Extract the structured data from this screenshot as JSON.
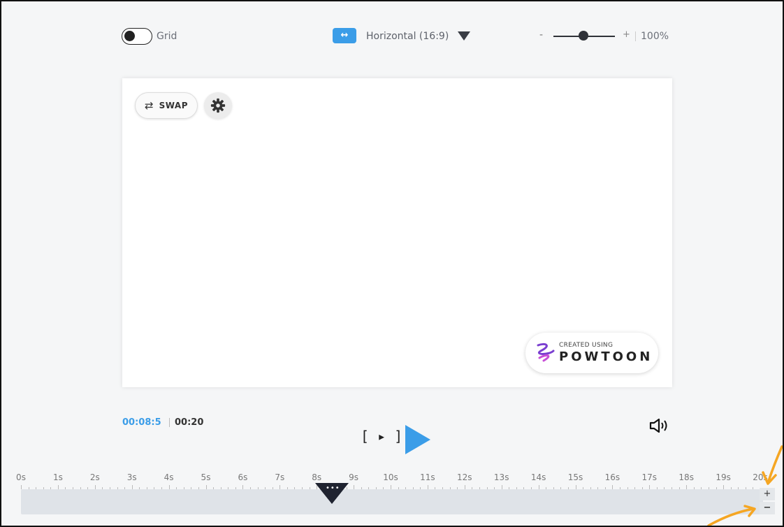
{
  "toolbar": {
    "grid_label": "Grid",
    "aspect_icon": "↔",
    "aspect_label": "Horizontal (16:9)",
    "zoom_minus": "-",
    "zoom_plus": "+",
    "zoom_value": "100%",
    "zoom_level_percent": 100
  },
  "canvas": {
    "swap_icon": "⇄",
    "swap_label": "SWAP",
    "settings_icon": "gear-icon",
    "badge_small": "CREATED USING",
    "badge_big": "POWTOON"
  },
  "playback": {
    "current_time": "00:08:5",
    "total_time": "00:20",
    "preview_icon": "[ ▸ ]",
    "play_icon": "play-icon",
    "volume_icon": "volume-icon"
  },
  "timeline": {
    "ticks": [
      "0s",
      "1s",
      "2s",
      "3s",
      "4s",
      "5s",
      "6s",
      "7s",
      "8s",
      "9s",
      "10s",
      "11s",
      "12s",
      "13s",
      "14s",
      "15s",
      "16s",
      "17s",
      "18s",
      "19s",
      "20s"
    ],
    "playhead_time_seconds": 8.5,
    "playhead_icon": "•••",
    "zoom_in": "+",
    "zoom_out": "−"
  },
  "colors": {
    "accent": "#3b9de8",
    "annotation": "#f5a623",
    "playhead": "#1f2330"
  }
}
